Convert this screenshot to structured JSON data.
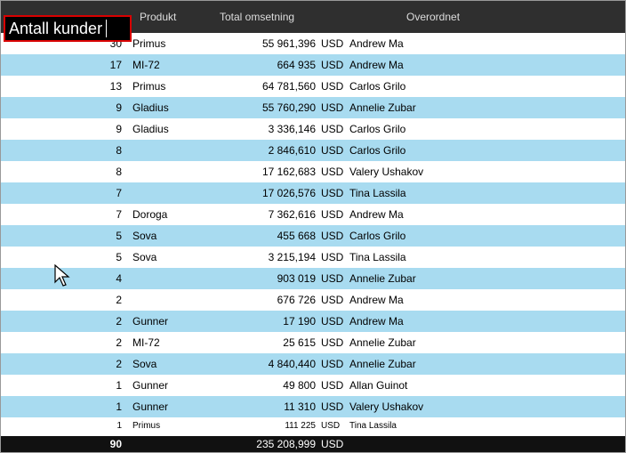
{
  "header": {
    "count": "Antall kunder",
    "product": "Produkt",
    "total": "Total omsetning",
    "over": "Overordnet"
  },
  "currency": "USD",
  "rows": [
    {
      "count": "30",
      "product": "Primus",
      "total": "55 961,396",
      "over": "Andrew Ma"
    },
    {
      "count": "17",
      "product": "MI-72",
      "total": "664 935",
      "over": "Andrew Ma"
    },
    {
      "count": "13",
      "product": "Primus",
      "total": "64 781,560",
      "over": "Carlos Grilo"
    },
    {
      "count": "9",
      "product": "Gladius",
      "total": "55 760,290",
      "over": "Annelie Zubar"
    },
    {
      "count": "9",
      "product": "Gladius",
      "total": "3 336,146",
      "over": "Carlos Grilo"
    },
    {
      "count": "8",
      "product": "",
      "total": "2 846,610",
      "over": "Carlos Grilo"
    },
    {
      "count": "8",
      "product": "",
      "total": "17 162,683",
      "over": "Valery Ushakov"
    },
    {
      "count": "7",
      "product": "",
      "total": "17 026,576",
      "over": "Tina Lassila"
    },
    {
      "count": "7",
      "product": "Doroga",
      "total": "7 362,616",
      "over": "Andrew Ma"
    },
    {
      "count": "5",
      "product": "Sova",
      "total": "455 668",
      "over": "Carlos Grilo"
    },
    {
      "count": "5",
      "product": "Sova",
      "total": "3 215,194",
      "over": "Tina Lassila"
    },
    {
      "count": "4",
      "product": "",
      "total": "903 019",
      "over": "Annelie Zubar"
    },
    {
      "count": "2",
      "product": "",
      "total": "676 726",
      "over": "Andrew Ma"
    },
    {
      "count": "2",
      "product": "Gunner",
      "total": "17 190",
      "over": "Andrew Ma"
    },
    {
      "count": "2",
      "product": "MI-72",
      "total": "25 615",
      "over": "Annelie Zubar"
    },
    {
      "count": "2",
      "product": "Sova",
      "total": "4 840,440",
      "over": "Annelie Zubar"
    },
    {
      "count": "1",
      "product": "Gunner",
      "total": "49 800",
      "over": "Allan Guinot"
    },
    {
      "count": "1",
      "product": "Gunner",
      "total": "11 310",
      "over": "Valery Ushakov"
    },
    {
      "count": "1",
      "product": "Primus",
      "total": "111 225",
      "over": "Tina Lassila",
      "partial": true
    }
  ],
  "footer": {
    "count": "90",
    "total": "235 208,999"
  },
  "chart_data": {
    "type": "table",
    "title": "Antall kunder",
    "columns": [
      "Antall kunder",
      "Produkt",
      "Total omsetning",
      "Overordnet"
    ],
    "rows": [
      [
        30,
        "Primus",
        "55 961,396 USD",
        "Andrew Ma"
      ],
      [
        17,
        "MI-72",
        "664 935 USD",
        "Andrew Ma"
      ],
      [
        13,
        "Primus",
        "64 781,560 USD",
        "Carlos Grilo"
      ],
      [
        9,
        "Gladius",
        "55 760,290 USD",
        "Annelie Zubar"
      ],
      [
        9,
        "Gladius",
        "3 336,146 USD",
        "Carlos Grilo"
      ],
      [
        8,
        "",
        "2 846,610 USD",
        "Carlos Grilo"
      ],
      [
        8,
        "",
        "17 162,683 USD",
        "Valery Ushakov"
      ],
      [
        7,
        "",
        "17 026,576 USD",
        "Tina Lassila"
      ],
      [
        7,
        "Doroga",
        "7 362,616 USD",
        "Andrew Ma"
      ],
      [
        5,
        "Sova",
        "455 668 USD",
        "Carlos Grilo"
      ],
      [
        5,
        "Sova",
        "3 215,194 USD",
        "Tina Lassila"
      ],
      [
        4,
        "",
        "903 019 USD",
        "Annelie Zubar"
      ],
      [
        2,
        "",
        "676 726 USD",
        "Andrew Ma"
      ],
      [
        2,
        "Gunner",
        "17 190 USD",
        "Andrew Ma"
      ],
      [
        2,
        "MI-72",
        "25 615 USD",
        "Annelie Zubar"
      ],
      [
        2,
        "Sova",
        "4 840,440 USD",
        "Annelie Zubar"
      ],
      [
        1,
        "Gunner",
        "49 800 USD",
        "Allan Guinot"
      ],
      [
        1,
        "Gunner",
        "11 310 USD",
        "Valery Ushakov"
      ],
      [
        1,
        "Primus",
        "111 225 USD",
        "Tina Lassila"
      ]
    ],
    "totals": {
      "Antall kunder": 90,
      "Total omsetning": "235 208,999 USD"
    }
  }
}
